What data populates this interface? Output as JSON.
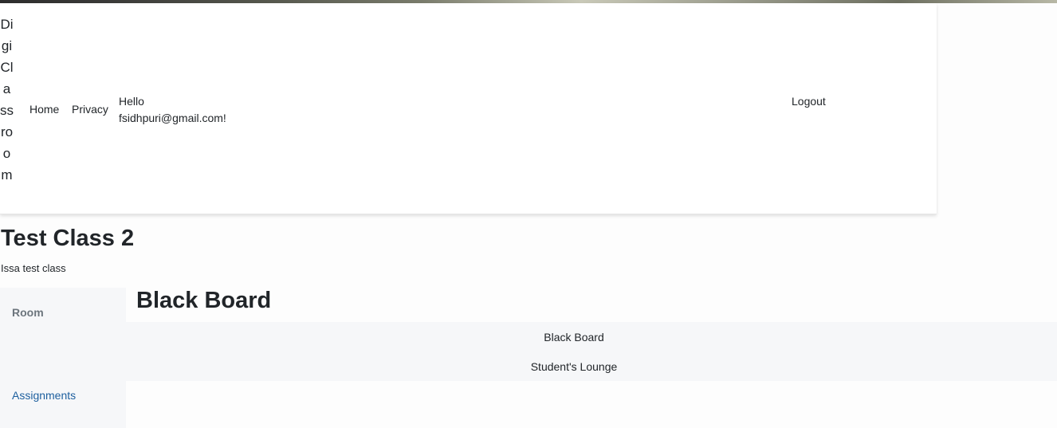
{
  "navbar": {
    "brand": "DigiClassroom",
    "links": [
      {
        "label": "Home"
      },
      {
        "label": "Privacy"
      }
    ],
    "greeting": "Hello fsidhpuri@gmail.com!",
    "logout_label": "Logout"
  },
  "class": {
    "title": "Test Class 2",
    "description": "Issa test class"
  },
  "sidebar": {
    "heading": "Room",
    "items": [
      {
        "label": "Assignments"
      }
    ]
  },
  "main": {
    "title": "Black Board",
    "room_options": [
      {
        "label": "Black Board"
      },
      {
        "label": "Student's Lounge"
      }
    ]
  }
}
